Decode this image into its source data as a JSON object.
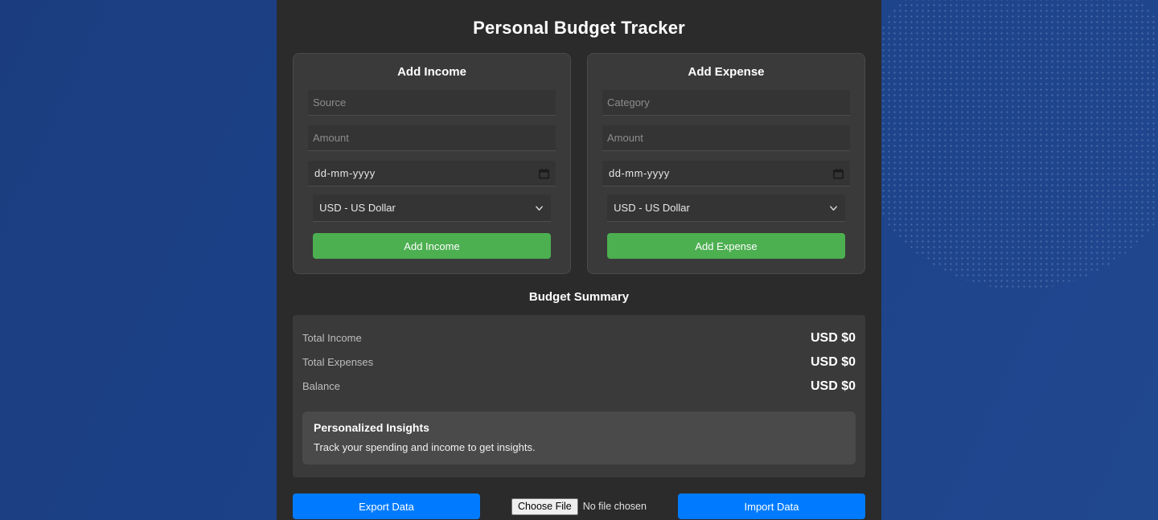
{
  "app": {
    "title": "Personal Budget Tracker"
  },
  "income_card": {
    "heading": "Add Income",
    "source_placeholder": "Source",
    "amount_placeholder": "Amount",
    "date_value": "dd-mm-yyyy",
    "currency_value": "USD - US Dollar",
    "submit_label": "Add Income"
  },
  "expense_card": {
    "heading": "Add Expense",
    "category_placeholder": "Category",
    "amount_placeholder": "Amount",
    "date_value": "dd-mm-yyyy",
    "currency_value": "USD - US Dollar",
    "submit_label": "Add Expense"
  },
  "summary": {
    "heading": "Budget Summary",
    "rows": [
      {
        "label": "Total Income",
        "value": "USD $0"
      },
      {
        "label": "Total Expenses",
        "value": "USD $0"
      },
      {
        "label": "Balance",
        "value": "USD $0"
      }
    ]
  },
  "insights": {
    "heading": "Personalized Insights",
    "text": "Track your spending and income to get insights."
  },
  "actions": {
    "export_label": "Export Data",
    "choose_file_label": "Choose File",
    "file_status": "No file chosen",
    "import_label": "Import Data"
  },
  "colors": {
    "background_blue": "#1d4289",
    "panel_dark": "#2b2b2b",
    "card_gray": "#3a3a3a",
    "insights_gray": "#4a4a4a",
    "accent_green": "#4caf50",
    "accent_blue": "#007bff"
  },
  "icons": {
    "calendar": "calendar-icon",
    "chevron": "chevron-down-icon"
  }
}
